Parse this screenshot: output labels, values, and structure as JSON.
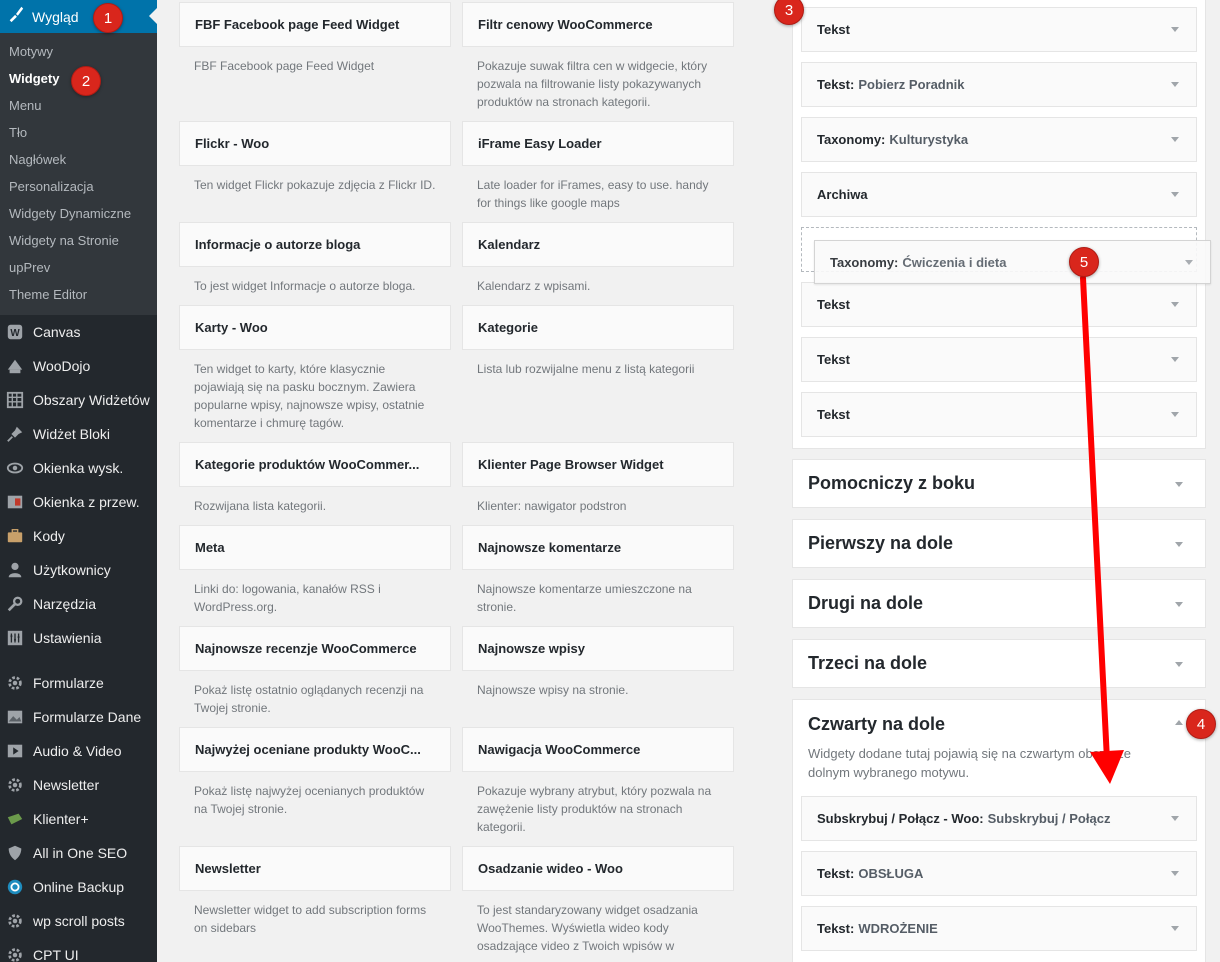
{
  "sidebar": {
    "active": "Wygląd",
    "submenu": [
      "Motywy",
      "Widgety",
      "Menu",
      "Tło",
      "Nagłówek",
      "Personalizacja",
      "Widgety Dynamiczne",
      "Widgety na Stronie",
      "upPrev",
      "Theme Editor"
    ],
    "current_sub": "Widgety",
    "items": [
      "Canvas",
      "WooDojo",
      "Obszary Widżetów",
      "Widżet Bloki",
      "Okienka wysk.",
      "Okienka z przew.",
      "Kody",
      "Użytkownicy",
      "Narzędzia",
      "Ustawienia",
      "Formularze",
      "Formularze Dane",
      "Audio & Video",
      "Newsletter",
      "Klienter+",
      "All in One SEO",
      "Online Backup",
      "wp scroll posts",
      "CPT UI"
    ]
  },
  "available_widgets": [
    {
      "title": "FBF Facebook page Feed Widget",
      "desc": "FBF Facebook page Feed Widget"
    },
    {
      "title": "Filtr cenowy WooCommerce",
      "desc": "Pokazuje suwak filtra cen w widgecie, który pozwala na filtrowanie listy pokazywanych produktów na stronach kategorii."
    },
    {
      "title": "Flickr - Woo",
      "desc": "Ten widget Flickr pokazuje zdjęcia z Flickr ID."
    },
    {
      "title": "iFrame Easy Loader",
      "desc": "Late loader for iFrames, easy to use. handy for things like google maps"
    },
    {
      "title": "Informacje o autorze bloga",
      "desc": "To jest widget Informacje o autorze bloga."
    },
    {
      "title": "Kalendarz",
      "desc": "Kalendarz z wpisami."
    },
    {
      "title": "Karty - Woo",
      "desc": "Ten widget to karty, które klasycznie pojawiają się na pasku bocznym. Zawiera popularne wpisy, najnowsze wpisy, ostatnie komentarze i chmurę tagów."
    },
    {
      "title": "Kategorie",
      "desc": "Lista lub rozwijalne menu z listą kategorii"
    },
    {
      "title": "Kategorie produktów WooCommer...",
      "desc": "Rozwijana lista kategorii."
    },
    {
      "title": "Klienter Page Browser Widget",
      "desc": "Klienter: nawigator podstron"
    },
    {
      "title": "Meta",
      "desc": "Linki do: logowania, kanałów RSS i WordPress.org."
    },
    {
      "title": "Najnowsze komentarze",
      "desc": "Najnowsze komentarze umieszczone na stronie."
    },
    {
      "title": "Najnowsze recenzje WooCommerce",
      "desc": "Pokaż listę ostatnio oglądanych recenzji na Twojej stronie."
    },
    {
      "title": "Najnowsze wpisy",
      "desc": "Najnowsze wpisy na stronie."
    },
    {
      "title": "Najwyżej oceniane produkty WooC...",
      "desc": "Pokaż listę najwyżej ocenianych produktów na Twojej stronie."
    },
    {
      "title": "Nawigacja WooCommerce",
      "desc": "Pokazuje wybrany atrybut, który pozwala na zawężenie listy produktów na stronach kategorii."
    },
    {
      "title": "Newsletter",
      "desc": "Newsletter widget to add subscription forms on sidebars"
    },
    {
      "title": "Osadzanie wideo - Woo",
      "desc": "To jest standaryzowany widget osadzania WooThemes. Wyświetla wideo kody osadzające video z Twoich wpisów w"
    }
  ],
  "area_widgets": [
    {
      "title": "Tekst",
      "sub": ""
    },
    {
      "title": "Tekst:",
      "sub": "Pobierz Poradnik"
    },
    {
      "title": "Taxonomy:",
      "sub": "Kulturystyka"
    },
    {
      "title": "Archiwa",
      "sub": ""
    },
    {
      "title": "Tekst",
      "sub": ""
    },
    {
      "title": "Tekst",
      "sub": ""
    },
    {
      "title": "Tekst",
      "sub": ""
    }
  ],
  "dragging_widget": {
    "title": "Taxonomy:",
    "sub": "Ćwiczenia i dieta"
  },
  "sidebar_areas": [
    "Pomocniczy z boku",
    "Pierwszy na dole",
    "Drugi na dole",
    "Trzeci na dole"
  ],
  "open_area": {
    "title": "Czwarty na dole",
    "desc": "Widgety dodane tutaj pojawią się na czwartym obszarze dolnym wybranego motywu.",
    "widgets": [
      {
        "title": "Subskrybuj / Połącz - Woo:",
        "sub": "Subskrybuj / Połącz"
      },
      {
        "title": "Tekst:",
        "sub": "OBSŁUGA"
      },
      {
        "title": "Tekst:",
        "sub": "WDROŻENIE"
      }
    ]
  },
  "badges": [
    "1",
    "2",
    "3",
    "4",
    "5"
  ],
  "colors": {
    "sidebar_bg": "#23282d",
    "active_bg": "#0073aa",
    "badge": "#d9261c",
    "arrow": "#ff0000"
  }
}
